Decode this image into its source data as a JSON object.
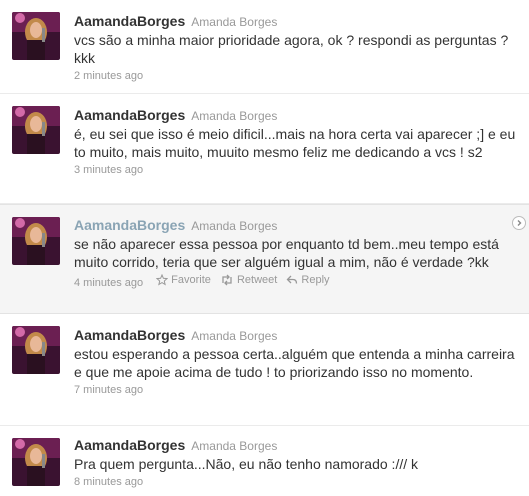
{
  "tweets": [
    {
      "screen_name": "AamandaBorges",
      "full_name": "Amanda Borges",
      "text": "vcs são a minha maior prioridade agora, ok ? respondi as perguntas ? kkk",
      "time": "2 minutes ago"
    },
    {
      "screen_name": "AamandaBorges",
      "full_name": "Amanda Borges",
      "text": "é, eu sei que isso é meio dificil...mais na hora certa vai aparecer ;] e eu to muito, mais muito, muuito mesmo feliz me dedicando a vcs ! s2",
      "time": "3 minutes ago"
    },
    {
      "screen_name": "AamandaBorges",
      "full_name": "Amanda Borges",
      "text": "se não aparecer essa pessoa por enquanto td bem..meu tempo está muito corrido, teria que ser alguém igual a mim, não é verdade ?kk",
      "time": "4 minutes ago",
      "actions": {
        "favorite": "Favorite",
        "retweet": "Retweet",
        "reply": "Reply"
      }
    },
    {
      "screen_name": "AamandaBorges",
      "full_name": "Amanda Borges",
      "text": "estou esperando a pessoa certa..alguém que entenda a minha carreira e que me apoie acima de tudo ! to priorizando isso no momento.",
      "time": "7 minutes ago"
    },
    {
      "screen_name": "AamandaBorges",
      "full_name": "Amanda Borges",
      "text": "Pra quem pergunta...Não, eu não tenho namorado :/// k",
      "time": "8 minutes ago"
    }
  ],
  "icons": {
    "avatar": "avatar-photo",
    "expand": "chevron-right-icon",
    "favorite": "star-icon",
    "retweet": "retweet-icon",
    "reply": "reply-arrow-icon"
  },
  "colors": {
    "screen_name": "#333333",
    "screen_name_hover": "#8aa4b4",
    "muted": "#999999",
    "hover_bg": "#f5f5f5"
  }
}
